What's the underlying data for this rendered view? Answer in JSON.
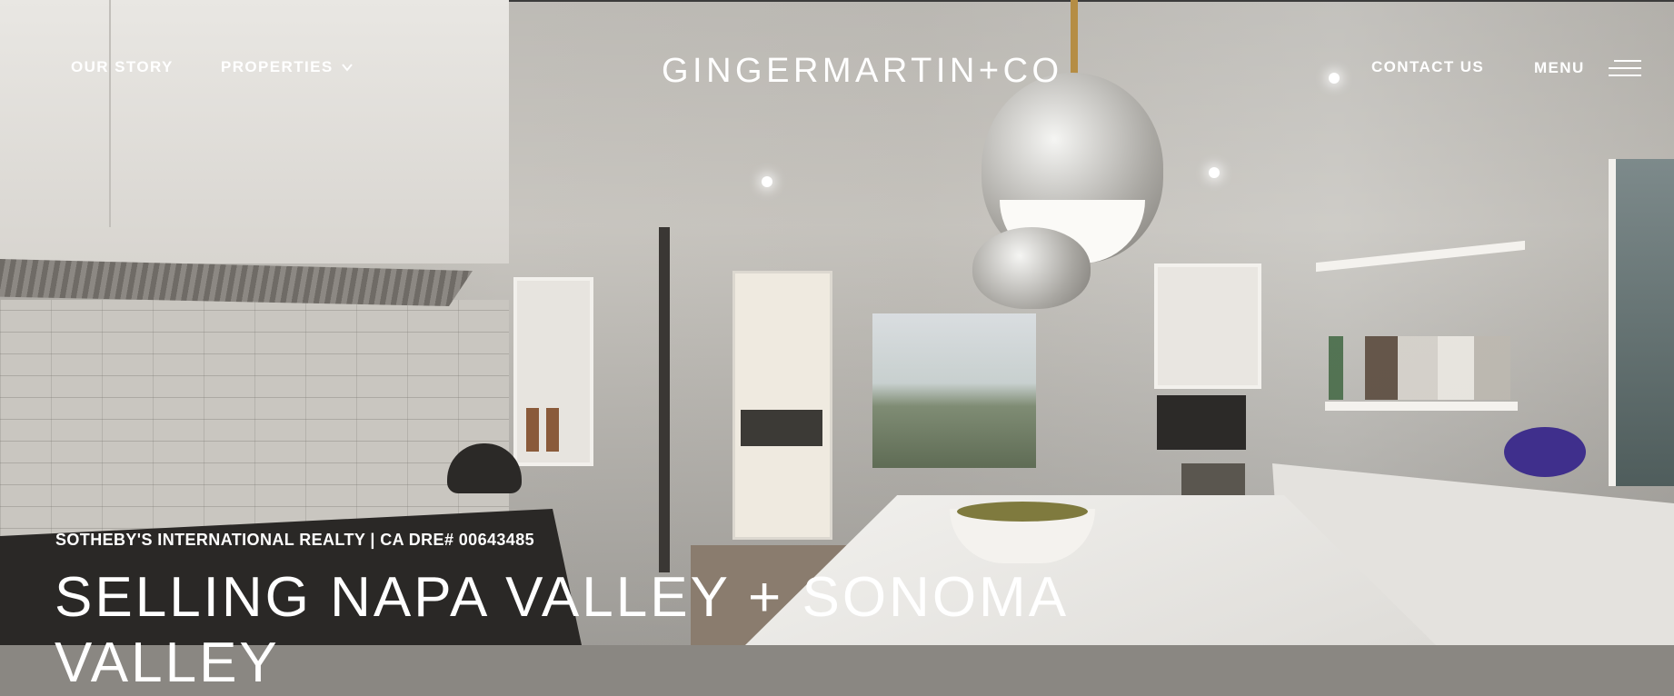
{
  "nav": {
    "our_story": "OUR STORY",
    "properties": "PROPERTIES",
    "contact": "CONTACT US",
    "menu": "MENU"
  },
  "brand": {
    "logo": "GINGERMARTIN+CO"
  },
  "hero": {
    "subhead": "SOTHEBY'S INTERNATIONAL REALTY | CA DRE# 00643485",
    "headline": "SELLING NAPA VALLEY + SONOMA VALLEY"
  },
  "icons": {
    "properties_dropdown": "chevron-down-icon",
    "menu": "hamburger-menu-icon"
  },
  "colors": {
    "text": "#ffffff"
  }
}
